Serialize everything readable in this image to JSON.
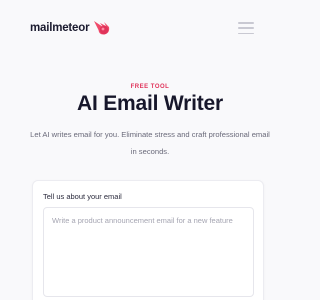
{
  "header": {
    "brand_name": "mailmeteor",
    "logo_icon": "meteor-logo-icon",
    "menu_icon": "hamburger-menu-icon"
  },
  "hero": {
    "eyebrow": "FREE TOOL",
    "title": "AI Email Writer",
    "subtitle": "Let AI writes email for you. Eliminate stress and craft professional email in seconds."
  },
  "form": {
    "label": "Tell us about your email",
    "value": "",
    "placeholder": "Write a product announcement email for a new feature"
  },
  "colors": {
    "accent": "#e0345a",
    "title": "#17172b",
    "muted": "#6a6a7a",
    "background": "#f9f9fb"
  }
}
